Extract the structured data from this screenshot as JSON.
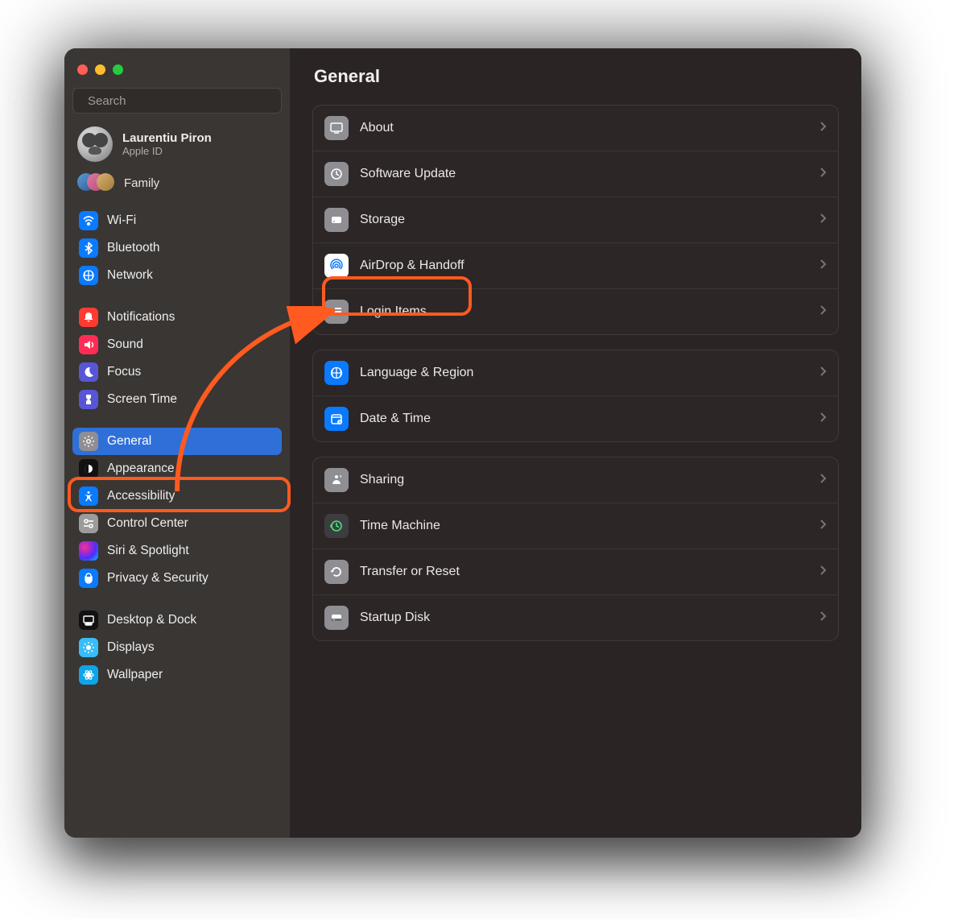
{
  "search": {
    "placeholder": "Search"
  },
  "account": {
    "name": "Laurentiu Piron",
    "sub": "Apple ID"
  },
  "family": {
    "label": "Family"
  },
  "sidebar": {
    "groups": [
      {
        "items": [
          {
            "label": "Wi-Fi"
          },
          {
            "label": "Bluetooth"
          },
          {
            "label": "Network"
          }
        ]
      },
      {
        "items": [
          {
            "label": "Notifications"
          },
          {
            "label": "Sound"
          },
          {
            "label": "Focus"
          },
          {
            "label": "Screen Time"
          }
        ]
      },
      {
        "items": [
          {
            "label": "General"
          },
          {
            "label": "Appearance"
          },
          {
            "label": "Accessibility"
          },
          {
            "label": "Control Center"
          },
          {
            "label": "Siri & Spotlight"
          },
          {
            "label": "Privacy & Security"
          }
        ]
      },
      {
        "items": [
          {
            "label": "Desktop & Dock"
          },
          {
            "label": "Displays"
          },
          {
            "label": "Wallpaper"
          }
        ]
      }
    ]
  },
  "main": {
    "title": "General",
    "panels": [
      {
        "rows": [
          {
            "label": "About"
          },
          {
            "label": "Software Update"
          },
          {
            "label": "Storage"
          },
          {
            "label": "AirDrop & Handoff"
          },
          {
            "label": "Login Items"
          }
        ]
      },
      {
        "rows": [
          {
            "label": "Language & Region"
          },
          {
            "label": "Date & Time"
          }
        ]
      },
      {
        "rows": [
          {
            "label": "Sharing"
          },
          {
            "label": "Time Machine"
          },
          {
            "label": "Transfer or Reset"
          },
          {
            "label": "Startup Disk"
          }
        ]
      }
    ]
  },
  "annotations": {
    "highlight_sidebar": "General",
    "highlight_main": "Login Items",
    "arrow_color": "#ff5a1f"
  }
}
